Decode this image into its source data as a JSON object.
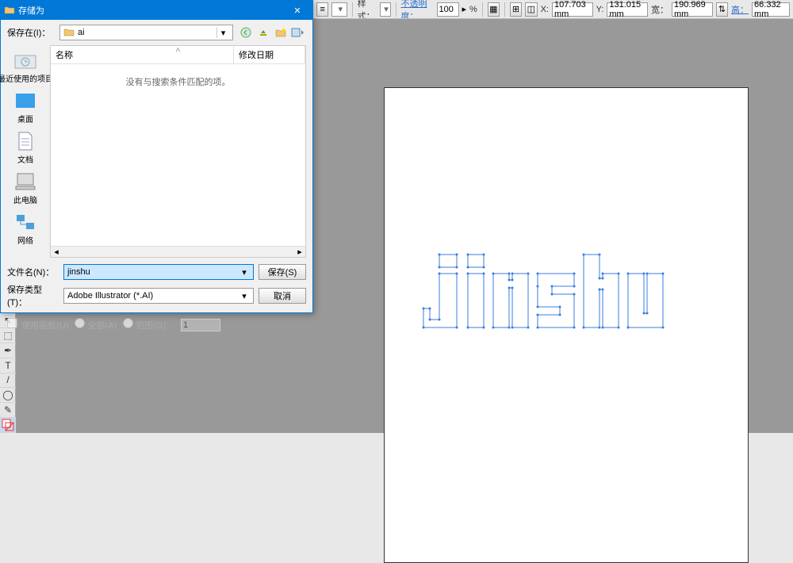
{
  "dialog": {
    "title": "存储为",
    "savein_label": "保存在(I)：",
    "savein_value": "ai",
    "nav": {
      "back": "back-icon",
      "up": "up-icon",
      "new": "new-folder-icon",
      "view": "view-menu-icon"
    },
    "places": [
      {
        "key": "recent",
        "label": "最近使用的项目"
      },
      {
        "key": "desktop",
        "label": "桌面"
      },
      {
        "key": "documents",
        "label": "文档"
      },
      {
        "key": "thispc",
        "label": "此电脑"
      },
      {
        "key": "network",
        "label": "网络"
      }
    ],
    "columns": {
      "name": "名称",
      "date": "修改日期"
    },
    "empty_text": "没有与搜索条件匹配的项。",
    "filename_label": "文件名(N)：",
    "filename_value": "jinshu",
    "filetype_label": "保存类型(T)：",
    "filetype_value": "Adobe Illustrator (*.AI)",
    "save_btn": "保存(S)",
    "cancel_btn": "取消",
    "artboard": {
      "use_label": "使用画板(U)",
      "all_label": "全部(A)",
      "range_label": "范围(G)：",
      "range_value": "1"
    }
  },
  "propbar": {
    "style_label": "样式：",
    "opacity_label": "不透明度：",
    "opacity_value": "100",
    "percent": "%",
    "x_label": "X:",
    "x_value": "107.703 mm",
    "y_label": "Y:",
    "y_value": "131.015 mm",
    "w_label": "宽：",
    "w_value": "190.969 mm",
    "h_label": "高：",
    "h_value": "66.332 mm"
  },
  "tools": [
    "↖",
    "⬚",
    "T",
    "/",
    "◯",
    "✎",
    "⬛",
    "◧"
  ]
}
